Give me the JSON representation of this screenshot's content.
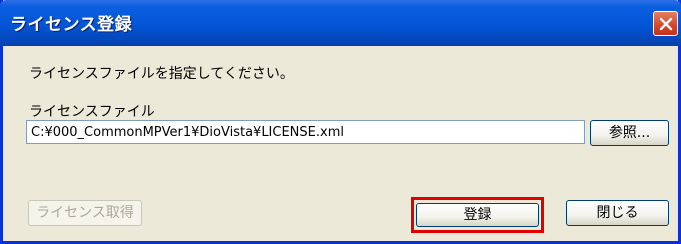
{
  "window": {
    "title": "ライセンス登録"
  },
  "dialog": {
    "instruction": "ライセンスファイルを指定してください。",
    "file_label": "ライセンスファイル",
    "file_path": "C:¥000_CommonMPVer1¥DioVista¥LICENSE.xml",
    "browse_label": "参照...",
    "obtain_license_label": "ライセンス取得",
    "register_label": "登録",
    "close_label": "閉じる"
  },
  "colors": {
    "title_bar": "#0454d6",
    "dialog_bg": "#ece9d8",
    "highlight": "#e00000"
  }
}
